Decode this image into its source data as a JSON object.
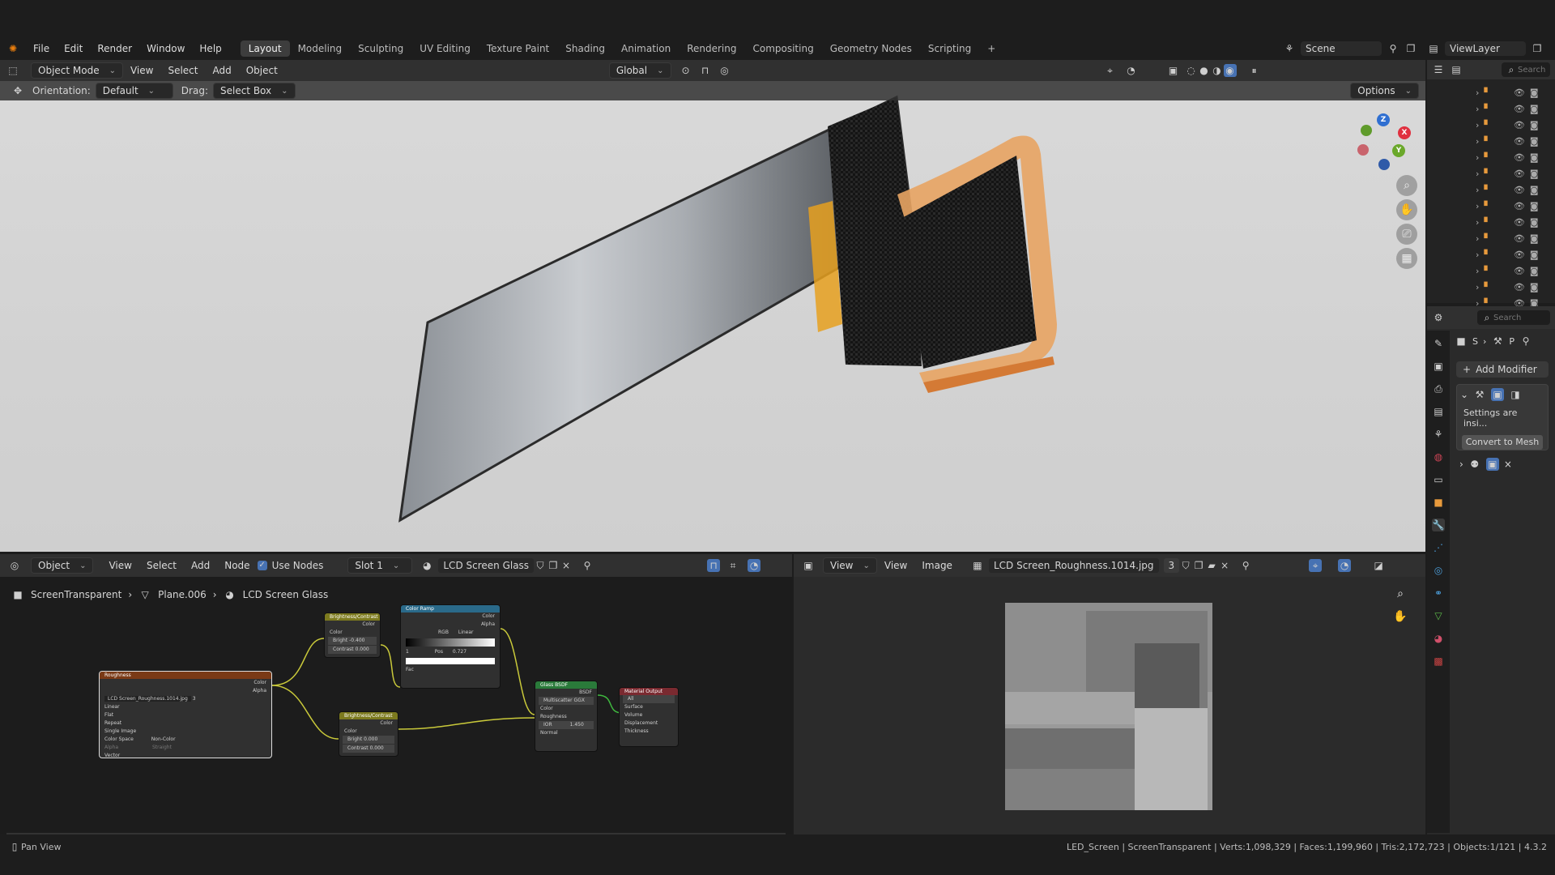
{
  "menu": {
    "file": "File",
    "edit": "Edit",
    "render": "Render",
    "window": "Window",
    "help": "Help"
  },
  "workspaces": [
    "Layout",
    "Modeling",
    "Sculpting",
    "UV Editing",
    "Texture Paint",
    "Shading",
    "Animation",
    "Rendering",
    "Compositing",
    "Geometry Nodes",
    "Scripting"
  ],
  "scene": {
    "label": "Scene"
  },
  "view_layer": {
    "label": "ViewLayer"
  },
  "viewport_header": {
    "mode": "Object Mode",
    "view": "View",
    "select": "Select",
    "add": "Add",
    "object": "Object",
    "transform": "Global"
  },
  "viewport_sub": {
    "orientation_label": "Orientation:",
    "orientation_value": "Default",
    "drag_label": "Drag:",
    "drag_value": "Select Box",
    "options": "Options"
  },
  "gizmo": {
    "x": "X",
    "y": "Y",
    "z": "Z"
  },
  "outliner": {
    "search_placeholder": "Search",
    "rows": 14
  },
  "properties": {
    "search_placeholder": "Search",
    "breadcrumb_s": "S",
    "breadcrumb_p": "P",
    "add_modifier": "Add Modifier",
    "settings_text": "Settings are insi...",
    "convert_to_mesh": "Convert to Mesh"
  },
  "node_editor": {
    "type": "Object",
    "view": "View",
    "select": "Select",
    "add": "Add",
    "node": "Node",
    "use_nodes": "Use Nodes",
    "slot": "Slot 1",
    "material": "LCD Screen Glass",
    "breadcrumb": {
      "object": "ScreenTransparent",
      "mesh": "Plane.006",
      "material": "LCD Screen Glass"
    }
  },
  "nodes": {
    "roughness": {
      "title": "Roughness",
      "color": "Color",
      "alpha": "Alpha",
      "image": "LCD Screen_Roughness.1014.jpg",
      "image_users": "3",
      "interp": "Linear",
      "proj": "Flat",
      "ext": "Repeat",
      "source": "Single Image",
      "colorspace_label": "Color Space",
      "colorspace": "Non-Color",
      "alpha_label": "Alpha",
      "alpha_mode": "Straight",
      "vector": "Vector"
    },
    "bc1": {
      "title": "Brightness/Contrast",
      "color_out": "Color",
      "color_in": "Color",
      "bright": "Bright",
      "bright_val": "-0.400",
      "contrast": "Contrast",
      "contrast_val": "0.000"
    },
    "bc2": {
      "title": "Brightness/Contrast",
      "color_out": "Color",
      "color_in": "Color",
      "bright": "Bright",
      "bright_val": "0.000",
      "contrast": "Contrast",
      "contrast_val": "0.000"
    },
    "ramp": {
      "title": "Color Ramp",
      "color": "Color",
      "alpha": "Alpha",
      "mode": "RGB",
      "interp": "Linear",
      "idx": "1",
      "pos": "Pos",
      "pos_val": "0.727",
      "fac": "Fac"
    },
    "glass": {
      "title": "Glass BSDF",
      "bsdf": "BSDF",
      "dist": "Multiscatter GGX",
      "color": "Color",
      "rough": "Roughness",
      "ior": "IOR",
      "ior_val": "1.450",
      "normal": "Normal"
    },
    "output": {
      "title": "Material Output",
      "target": "All",
      "surface": "Surface",
      "volume": "Volume",
      "displacement": "Displacement",
      "thickness": "Thickness"
    }
  },
  "image_editor": {
    "view": "View",
    "view2": "View",
    "image": "Image",
    "image_name": "LCD Screen_Roughness.1014.jpg",
    "users": "3"
  },
  "status": {
    "left": "Pan View",
    "right": "LED_Screen | ScreenTransparent | Verts:1,098,329 | Faces:1,199,960 | Tris:2,172,723 | Objects:1/121 | 4.3.2"
  }
}
